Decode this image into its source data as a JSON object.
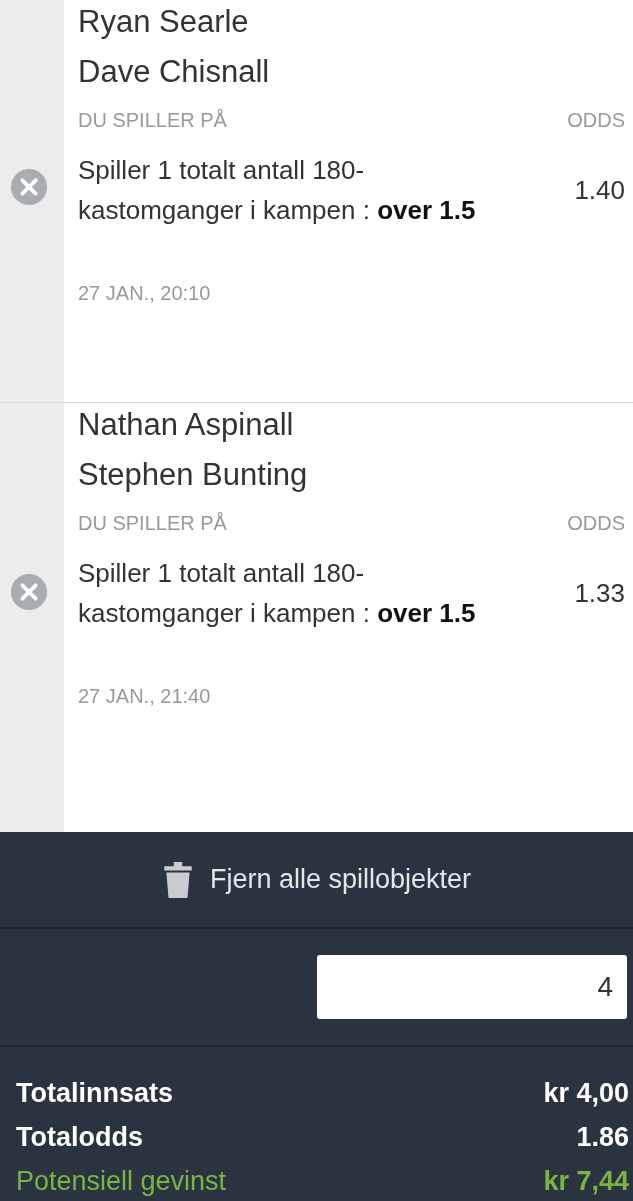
{
  "bets": [
    {
      "players": [
        "Ryan Searle",
        "Dave Chisnall"
      ],
      "pick_label": "DU SPILLER PÅ",
      "odds_label": "ODDS",
      "selection": "Spiller 1 totalt antall 180-kastomganger i kampen : **over 1.5**",
      "odds": "1.40",
      "time": "27 JAN., 20:10"
    },
    {
      "players": [
        "Nathan Aspinall",
        "Stephen Bunting"
      ],
      "pick_label": "DU SPILLER PÅ",
      "odds_label": "ODDS",
      "selection": "Spiller 1 totalt antall 180-kastomganger i kampen : **over 1.5**",
      "odds": "1.33",
      "time": "27 JAN., 21:40"
    }
  ],
  "remove_all": "Fjern alle spillobjekter",
  "stake": {
    "value": "4"
  },
  "totals": [
    {
      "label": "Totalinnsats",
      "value": "kr 4,00",
      "kind": "plain"
    },
    {
      "label": "Totalodds",
      "value": "1.86",
      "kind": "plain"
    },
    {
      "label": "Potensiell gevinst",
      "value": "kr 7,44",
      "kind": "highlight"
    }
  ]
}
